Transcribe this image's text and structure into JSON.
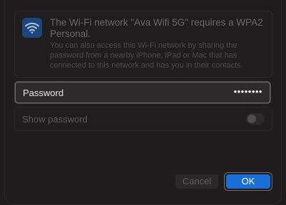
{
  "dialog": {
    "title": "The Wi-Fi network \"Ava Wifi 5G\" requires a WPA2 Personal.",
    "description": "You can also access this Wi-Fi network by sharing the password from a nearby iPhone, iPad or Mac that has connected to this network and has you in their contacts.",
    "icon": "wifi-icon",
    "accent_color": "#1a6ed8"
  },
  "password": {
    "label": "Password",
    "value": "••••••••"
  },
  "show_password": {
    "label": "Show password",
    "enabled": false
  },
  "buttons": {
    "cancel_label": "Cancel",
    "ok_label": "OK"
  }
}
